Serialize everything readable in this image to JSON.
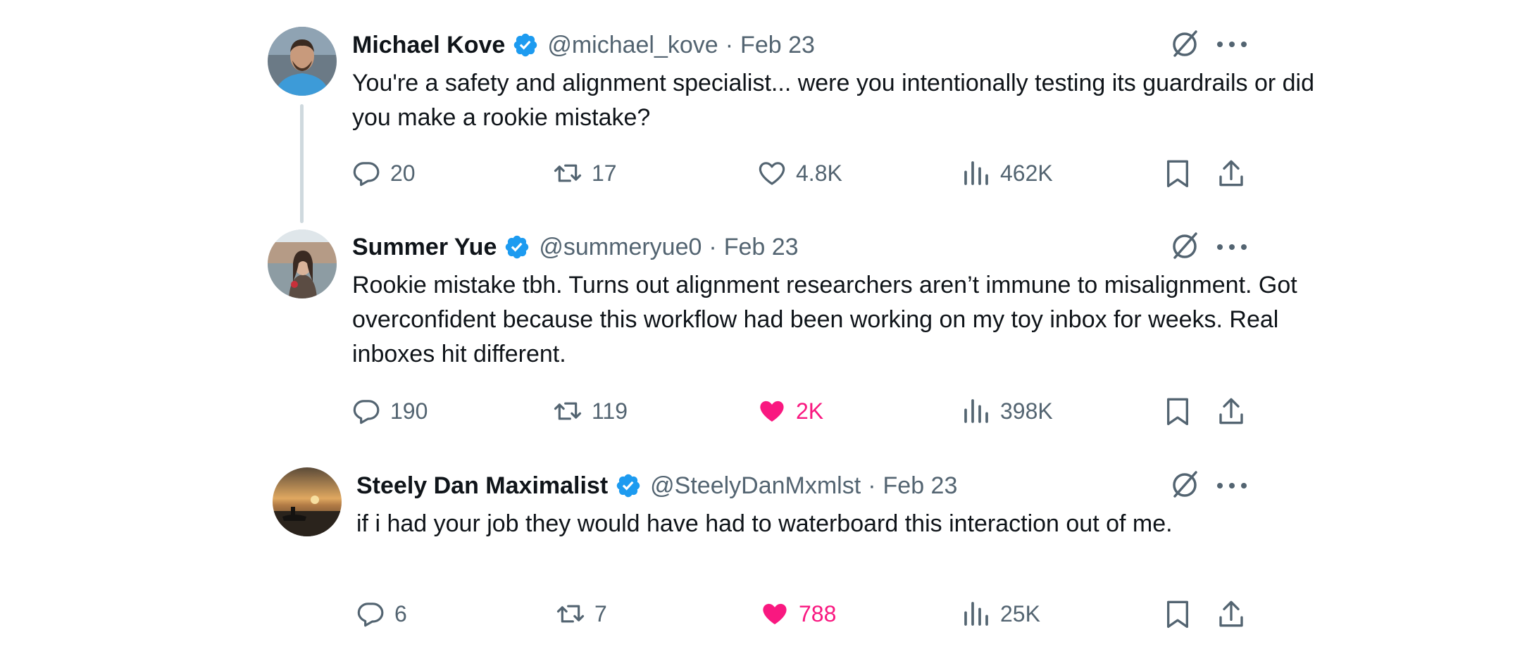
{
  "colors": {
    "verified": "#1d9bf0",
    "muted": "#536471",
    "like_active": "#f91880",
    "thread_line": "#cfd9de"
  },
  "tweets": [
    {
      "name": "Michael Kove",
      "handle": "@michael_kove",
      "separator": "·",
      "date": "Feb 23",
      "text": "You're a safety and alignment specialist... were you intentionally testing its guardrails or did you make a rookie mistake?",
      "replies": "20",
      "retweets": "17",
      "likes": "4.8K",
      "liked": false,
      "views": "462K",
      "avatar_icon": "avatar-photo"
    },
    {
      "name": "Summer Yue",
      "handle": "@summeryue0",
      "separator": "·",
      "date": "Feb 23",
      "text": "Rookie mistake tbh. Turns out alignment researchers aren’t immune to misalignment. Got overconfident because this workflow had been working on my toy inbox for weeks. Real inboxes hit different.",
      "replies": "190",
      "retweets": "119",
      "likes": "2K",
      "liked": true,
      "views": "398K",
      "avatar_icon": "avatar-photo"
    },
    {
      "name": "Steely Dan Maximalist",
      "handle": "@SteelyDanMxmlst",
      "separator": "·",
      "date": "Feb 23",
      "text": "if i had your job they would have had to waterboard this interaction out of me.",
      "replies": "6",
      "retweets": "7",
      "likes": "788",
      "liked": true,
      "views": "25K",
      "avatar_icon": "avatar-photo"
    }
  ],
  "icons": [
    "reply-icon",
    "retweet-icon",
    "like-icon",
    "views-icon",
    "bookmark-icon",
    "share-icon",
    "grok-icon",
    "more-icon",
    "verified-badge-icon"
  ]
}
